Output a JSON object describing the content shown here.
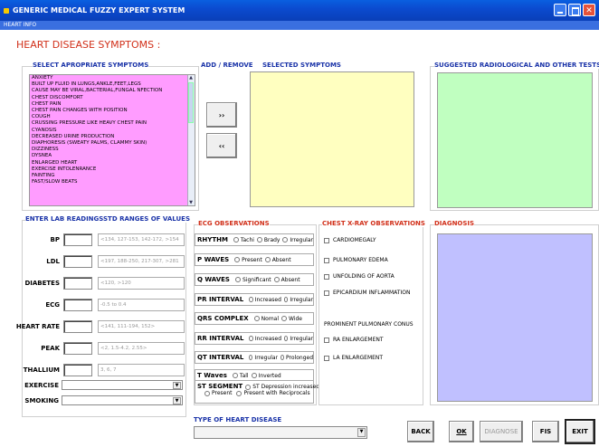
{
  "window": {
    "title": "GENERIC MEDICAL FUZZY EXPERT SYSTEM",
    "menu": "HEART INFO"
  },
  "heading": "HEART DISEASE SYMPTOMS :",
  "symptoms": {
    "title": "SELECT APROPRIATE SYMPTOMS",
    "items": [
      "ANXIETY",
      "BUILT UP FLUID IN LUNGS,ANKLE,FEET,LEGS",
      "CAUSE MAY BE VIRAL,BACTERIAL,FUNGAL NFECTION",
      "CHEST DISCOMFORT",
      "CHEST PAIN",
      "CHEST PAIN CHANGES WITH POSITION",
      "COUGH",
      "CRUSSING PRESSURE LIKE HEAVY CHEST PAIN",
      "CYANOSIS",
      "DECREASED URINE PRODUCTION",
      "DIAPHORESIS (SWEATY PALMS, CLAMMY SKIN)",
      "DIZZINESS",
      "DYSNEA",
      "ENLARGED HEART",
      "EXERCISE INTOLENRANCE",
      "FAINTING",
      "FAST/SLOW BEATS"
    ]
  },
  "add_remove": {
    "title": "ADD / REMOVE",
    "add": "››",
    "remove": "‹‹"
  },
  "selected": {
    "title": "SELECTED SYMPTOMS"
  },
  "tests": {
    "title": "SUGGESTED RADIOLOGICAL AND OTHER TESTS"
  },
  "lab": {
    "title": "ENTER LAB READINGS",
    "std_title": "STD RANGES OF VALUES",
    "rows": [
      {
        "label": "BP",
        "range": "<134, 127-153, 142-172, >154"
      },
      {
        "label": "LDL",
        "range": "<197, 188-250, 217-307, >281"
      },
      {
        "label": "DIABETES",
        "range": "<120, >120"
      },
      {
        "label": "ECG",
        "range": "-0.5 to 0.4"
      },
      {
        "label": "HEART RATE",
        "range": "<141, 111-194, 152>"
      },
      {
        "label": "PEAK",
        "range": "<2, 1.5-4.2, 2.55>"
      },
      {
        "label": "THALLIUM",
        "range": "3, 6, 7"
      }
    ],
    "exercise": "EXERCISE",
    "smoking": "SMOKING"
  },
  "ecg": {
    "title": "ECG OBSERVATIONS",
    "rows": [
      {
        "label": "RHYTHM",
        "options": [
          "Tachi",
          "Brady",
          "Irregular"
        ]
      },
      {
        "label": "P WAVES",
        "options": [
          "Present",
          "Absent"
        ]
      },
      {
        "label": "Q WAVES",
        "options": [
          "Significant",
          "Absent"
        ]
      },
      {
        "label": "PR INTERVAL",
        "options": [
          "Increased",
          "Irregular"
        ]
      },
      {
        "label": "QRS COMPLEX",
        "options": [
          "Nomal",
          "Wide"
        ]
      },
      {
        "label": "RR INTERVAL",
        "options": [
          "Increased",
          "Irregular"
        ]
      },
      {
        "label": "QT INTERVAL",
        "options": [
          "Irregular",
          "Prolonged"
        ]
      },
      {
        "label": "T Waves",
        "options": [
          "Tall",
          "Inverted"
        ]
      }
    ],
    "st": {
      "label": "ST SEGMENT",
      "opt1": "ST Depression increased",
      "opt2": "Present",
      "opt3": "Present with Reciprocals"
    }
  },
  "xray": {
    "title": "CHEST X-RAY OBSERVATIONS",
    "items": [
      "CARDIOMEGALY",
      "PULMONARY EDEMA",
      "UNFOLDING OF AORTA",
      "EPICARDIUM INFLAMMATION"
    ],
    "conus": "PROMINENT PULMONARY CONUS",
    "items2": [
      "RA ENLARGEMENT",
      "LA ENLARGEMENT"
    ]
  },
  "diagnosis": {
    "title": "DIAGNOSIS"
  },
  "type": {
    "title": "TYPE OF HEART DISEASE"
  },
  "buttons": {
    "back": "BACK",
    "ok": "OK",
    "diagnose": "DIAGNOSE",
    "fis": "FIS",
    "exit": "EXIT"
  },
  "colors": {
    "symptom_list": "#ff9cff",
    "selected": "#ffffc0",
    "tests": "#c0ffc0",
    "diagnosis": "#c0c0ff"
  }
}
